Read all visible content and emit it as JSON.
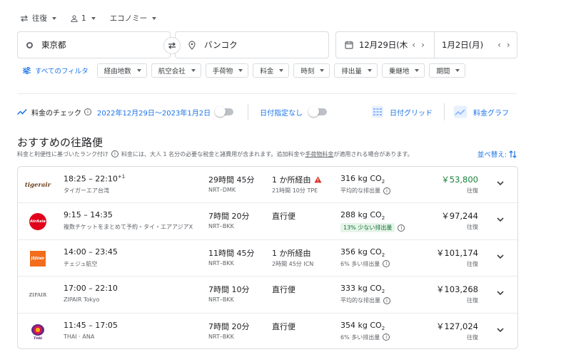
{
  "top": {
    "trip_type": "往復",
    "passengers": "1",
    "cabin": "エコノミー"
  },
  "search": {
    "origin": "東京都",
    "destination": "バンコク",
    "depart_date": "12月29日(木",
    "return_date": "1月2日(月)"
  },
  "filters": {
    "all_label": "すべてのフィルタ",
    "chips": [
      "経由地数",
      "航空会社",
      "手荷物",
      "料金",
      "時刻",
      "排出量",
      "乗継地",
      "期間"
    ]
  },
  "tracking": {
    "label": "料金のチェック",
    "range": "2022年12月29日〜2023年1月2日",
    "any_dates": "日付指定なし",
    "date_grid": "日付グリッド",
    "price_graph": "料金グラフ"
  },
  "results": {
    "heading": "おすすめの往路便",
    "rank_note": "料金と利便性に基づいたランク付け",
    "tax_note_a": "料金には、大人 1 名分の必要な税金と諸費用が含まれます。追加料金や",
    "tax_note_link": "手荷物料金",
    "tax_note_b": "が適用される場合があります。",
    "sort_label": "並べ替え:"
  },
  "flights": [
    {
      "logo": "tigerair",
      "times": "18:25 – 22:10",
      "plus": "+1",
      "airline": "タイガーエア台湾",
      "duration": "29時間 45分",
      "route": "NRT–DMK",
      "stops": "1 か所経由",
      "warn": true,
      "stop_detail": "21時間 10分 TPE",
      "co2": "316 kg CO",
      "emission": "平均的な排出量",
      "emission_good": false,
      "price": "￥53,800",
      "price_green": true,
      "price_type": "往復"
    },
    {
      "logo": "AirAsia",
      "times": "9:15 – 14:35",
      "plus": "",
      "airline": "複数チケットをまとめて予約・タイ・エアアジアX",
      "duration": "7時間 20分",
      "route": "NRT–BKK",
      "stops": "直行便",
      "warn": false,
      "stop_detail": "",
      "co2": "288 kg CO",
      "emission": "13% 少ない排出量",
      "emission_good": true,
      "price": "￥97,244",
      "price_green": false,
      "price_type": "往復"
    },
    {
      "logo": "JEJUair",
      "times": "14:00 – 23:45",
      "plus": "",
      "airline": "チェジュ航空",
      "duration": "11時間 45分",
      "route": "NRT–BKK",
      "stops": "1 か所経由",
      "warn": false,
      "stop_detail": "2時間 45分 ICN",
      "co2": "356 kg CO",
      "emission": "6% 多い排出量",
      "emission_good": false,
      "price": "￥101,174",
      "price_green": false,
      "price_type": "往復"
    },
    {
      "logo": "ZIPAIR",
      "times": "17:00 – 22:10",
      "plus": "",
      "airline": "ZIPAIR Tokyo",
      "duration": "7時間 10分",
      "route": "NRT–BKK",
      "stops": "直行便",
      "warn": false,
      "stop_detail": "",
      "co2": "333 kg CO",
      "emission": "平均的な排出量",
      "emission_good": false,
      "price": "￥103,268",
      "price_green": false,
      "price_type": "往復"
    },
    {
      "logo": "THAI",
      "times": "11:45 – 17:05",
      "plus": "",
      "airline": "THAI · ANA",
      "duration": "7時間 20分",
      "route": "NRT–BKK",
      "stops": "直行便",
      "warn": false,
      "stop_detail": "",
      "co2": "354 kg CO",
      "emission": "6% 多い排出量",
      "emission_good": false,
      "price": "￥127,024",
      "price_green": false,
      "price_type": "往復"
    }
  ],
  "colors": {
    "accent": "#1a73e8",
    "green": "#188038",
    "border": "#dadce0"
  }
}
